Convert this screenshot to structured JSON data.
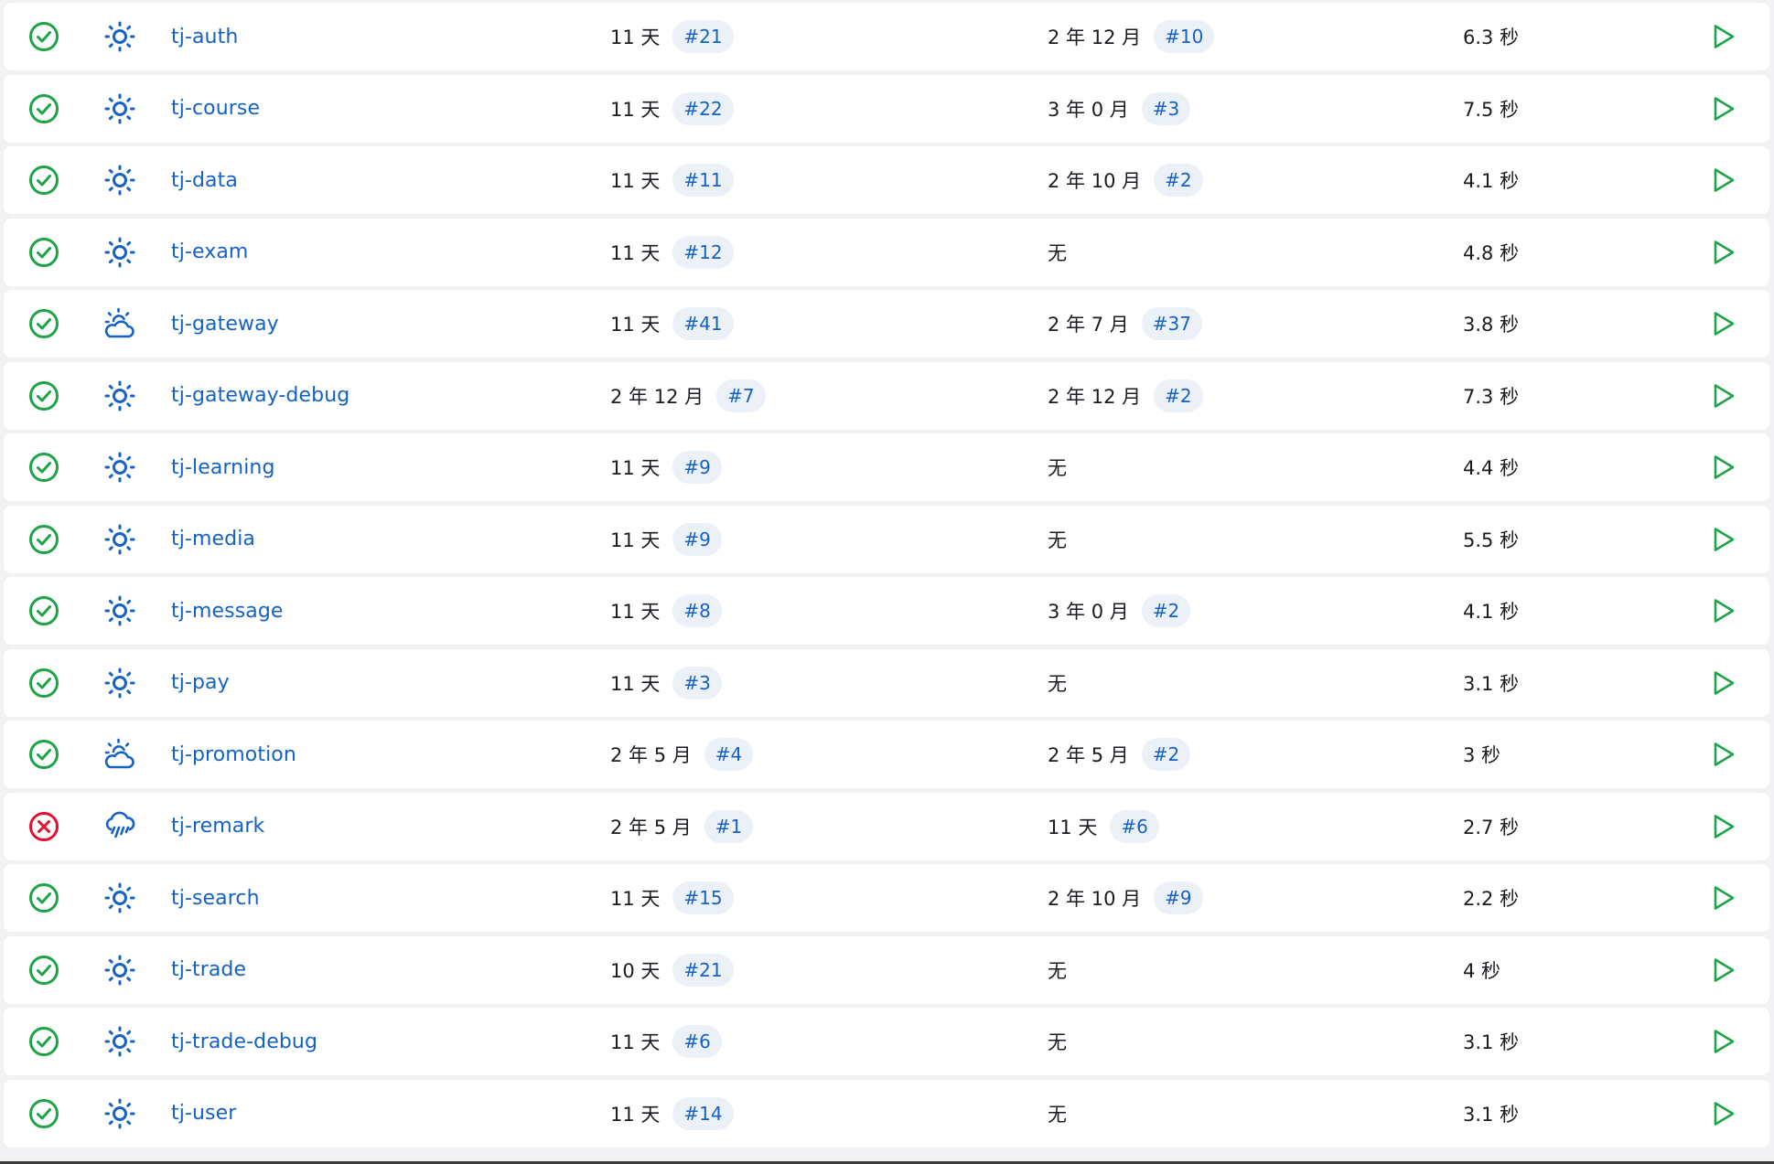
{
  "jobs": [
    {
      "status": "success",
      "weather": "sunny",
      "name": "tj-auth",
      "last_success": {
        "time": "11 天",
        "build": "#21"
      },
      "last_failure": {
        "time": "2 年 12 月",
        "build": "#10"
      },
      "duration": "6.3 秒"
    },
    {
      "status": "success",
      "weather": "sunny",
      "name": "tj-course",
      "last_success": {
        "time": "11 天",
        "build": "#22"
      },
      "last_failure": {
        "time": "3 年 0 月",
        "build": "#3"
      },
      "duration": "7.5 秒"
    },
    {
      "status": "success",
      "weather": "sunny",
      "name": "tj-data",
      "last_success": {
        "time": "11 天",
        "build": "#11"
      },
      "last_failure": {
        "time": "2 年 10 月",
        "build": "#2"
      },
      "duration": "4.1 秒"
    },
    {
      "status": "success",
      "weather": "sunny",
      "name": "tj-exam",
      "last_success": {
        "time": "11 天",
        "build": "#12"
      },
      "last_failure": {
        "time": "无",
        "build": ""
      },
      "duration": "4.8 秒"
    },
    {
      "status": "success",
      "weather": "partly-cloudy",
      "name": "tj-gateway",
      "last_success": {
        "time": "11 天",
        "build": "#41"
      },
      "last_failure": {
        "time": "2 年 7 月",
        "build": "#37"
      },
      "duration": "3.8 秒"
    },
    {
      "status": "success",
      "weather": "sunny",
      "name": "tj-gateway-debug",
      "last_success": {
        "time": "2 年 12 月",
        "build": "#7"
      },
      "last_failure": {
        "time": "2 年 12 月",
        "build": "#2"
      },
      "duration": "7.3 秒"
    },
    {
      "status": "success",
      "weather": "sunny",
      "name": "tj-learning",
      "last_success": {
        "time": "11 天",
        "build": "#9"
      },
      "last_failure": {
        "time": "无",
        "build": ""
      },
      "duration": "4.4 秒"
    },
    {
      "status": "success",
      "weather": "sunny",
      "name": "tj-media",
      "last_success": {
        "time": "11 天",
        "build": "#9"
      },
      "last_failure": {
        "time": "无",
        "build": ""
      },
      "duration": "5.5 秒"
    },
    {
      "status": "success",
      "weather": "sunny",
      "name": "tj-message",
      "last_success": {
        "time": "11 天",
        "build": "#8"
      },
      "last_failure": {
        "time": "3 年 0 月",
        "build": "#2"
      },
      "duration": "4.1 秒"
    },
    {
      "status": "success",
      "weather": "sunny",
      "name": "tj-pay",
      "last_success": {
        "time": "11 天",
        "build": "#3"
      },
      "last_failure": {
        "time": "无",
        "build": ""
      },
      "duration": "3.1 秒"
    },
    {
      "status": "success",
      "weather": "partly-cloudy",
      "name": "tj-promotion",
      "last_success": {
        "time": "2 年 5 月",
        "build": "#4"
      },
      "last_failure": {
        "time": "2 年 5 月",
        "build": "#2"
      },
      "duration": "3 秒"
    },
    {
      "status": "failure",
      "weather": "rainy",
      "name": "tj-remark",
      "last_success": {
        "time": "2 年 5 月",
        "build": "#1"
      },
      "last_failure": {
        "time": "11 天",
        "build": "#6"
      },
      "duration": "2.7 秒"
    },
    {
      "status": "success",
      "weather": "sunny",
      "name": "tj-search",
      "last_success": {
        "time": "11 天",
        "build": "#15"
      },
      "last_failure": {
        "time": "2 年 10 月",
        "build": "#9"
      },
      "duration": "2.2 秒"
    },
    {
      "status": "success",
      "weather": "sunny",
      "name": "tj-trade",
      "last_success": {
        "time": "10 天",
        "build": "#21"
      },
      "last_failure": {
        "time": "无",
        "build": ""
      },
      "duration": "4 秒"
    },
    {
      "status": "success",
      "weather": "sunny",
      "name": "tj-trade-debug",
      "last_success": {
        "time": "11 天",
        "build": "#6"
      },
      "last_failure": {
        "time": "无",
        "build": ""
      },
      "duration": "3.1 秒"
    },
    {
      "status": "success",
      "weather": "sunny",
      "name": "tj-user",
      "last_success": {
        "time": "11 天",
        "build": "#14"
      },
      "last_failure": {
        "time": "无",
        "build": ""
      },
      "duration": "3.1 秒"
    }
  ],
  "colors": {
    "success": "#1ea446",
    "failure": "#e0102f",
    "link": "#1462c4",
    "weather": "#1462c4",
    "play": "#1ea446",
    "badge_bg": "#ecf1f8",
    "row_bg": "#ffffff",
    "page_bg": "#f2f2f5"
  }
}
